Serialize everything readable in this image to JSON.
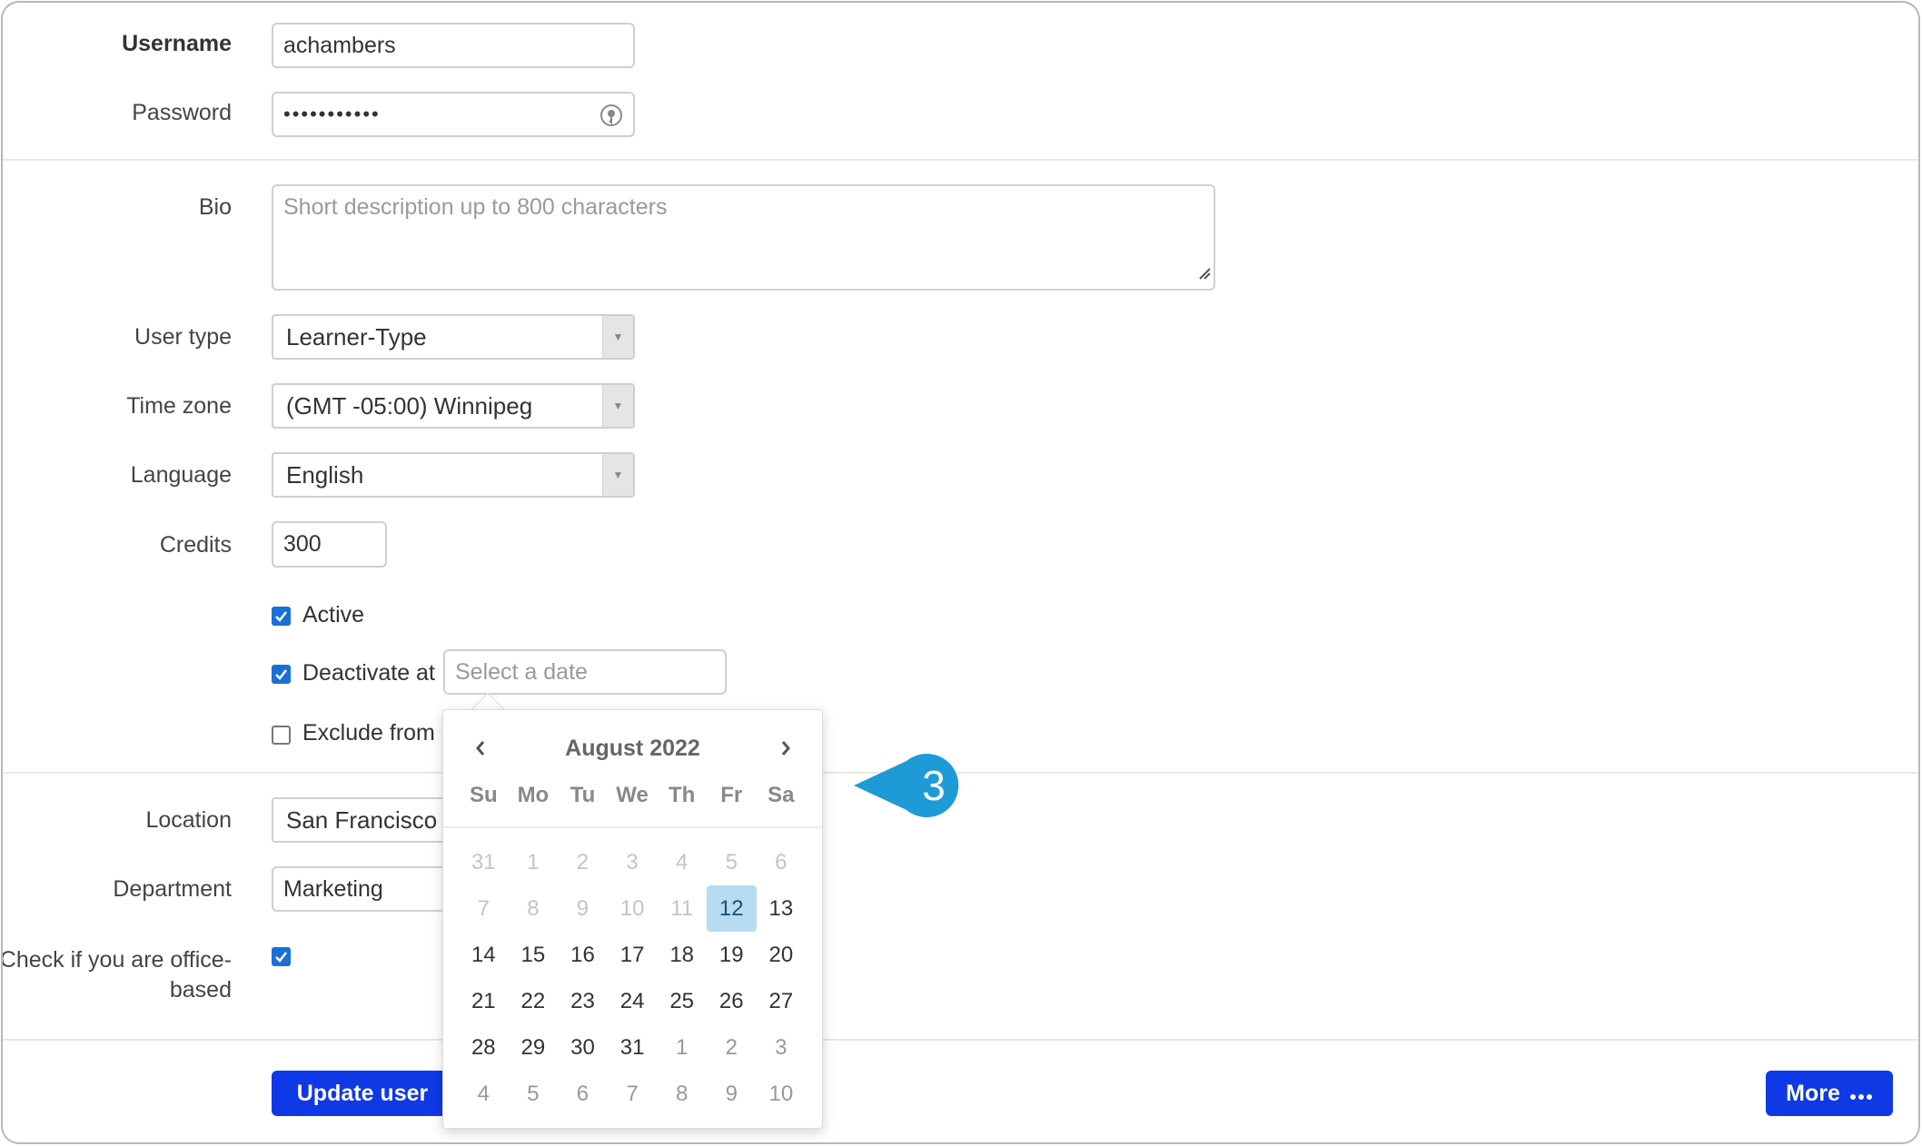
{
  "form": {
    "username": {
      "label": "Username",
      "value": "achambers"
    },
    "password": {
      "label": "Password",
      "value": "•••••••••••"
    },
    "bio": {
      "label": "Bio",
      "placeholder": "Short description up to 800 characters"
    },
    "user_type": {
      "label": "User type",
      "value": "Learner-Type"
    },
    "time_zone": {
      "label": "Time zone",
      "value": "(GMT -05:00) Winnipeg"
    },
    "language": {
      "label": "Language",
      "value": "English"
    },
    "credits": {
      "label": "Credits",
      "value": "300"
    },
    "active": {
      "label": "Active",
      "checked": true
    },
    "deactivate": {
      "label": "Deactivate at",
      "checked": true,
      "placeholder": "Select a date"
    },
    "exclude": {
      "label": "Exclude from e",
      "checked": false
    },
    "location": {
      "label": "Location",
      "value": "San Francisco"
    },
    "department": {
      "label": "Department",
      "value": "Marketing"
    },
    "office_based": {
      "label_line1": "Check if you are office-",
      "label_line2": "based",
      "checked": true
    }
  },
  "actions": {
    "update_label": "Update user",
    "more_label": "More"
  },
  "datepicker": {
    "month_label": "August 2022",
    "weekdays": [
      "Su",
      "Mo",
      "Tu",
      "We",
      "Th",
      "Fr",
      "Sa"
    ],
    "weeks": [
      [
        "31",
        "1",
        "2",
        "3",
        "4",
        "5",
        "6"
      ],
      [
        "7",
        "8",
        "9",
        "10",
        "11",
        "12",
        "13"
      ],
      [
        "14",
        "15",
        "16",
        "17",
        "18",
        "19",
        "20"
      ],
      [
        "21",
        "22",
        "23",
        "24",
        "25",
        "26",
        "27"
      ],
      [
        "28",
        "29",
        "30",
        "31",
        "1",
        "2",
        "3"
      ],
      [
        "4",
        "5",
        "6",
        "7",
        "8",
        "9",
        "10"
      ]
    ],
    "today": "12"
  },
  "step_badge": {
    "number": "3"
  },
  "colors": {
    "primary": "#0f39e6",
    "checkbox": "#1a6fd6",
    "today": "#b7dbf1",
    "badge": "#1e9ad6"
  }
}
